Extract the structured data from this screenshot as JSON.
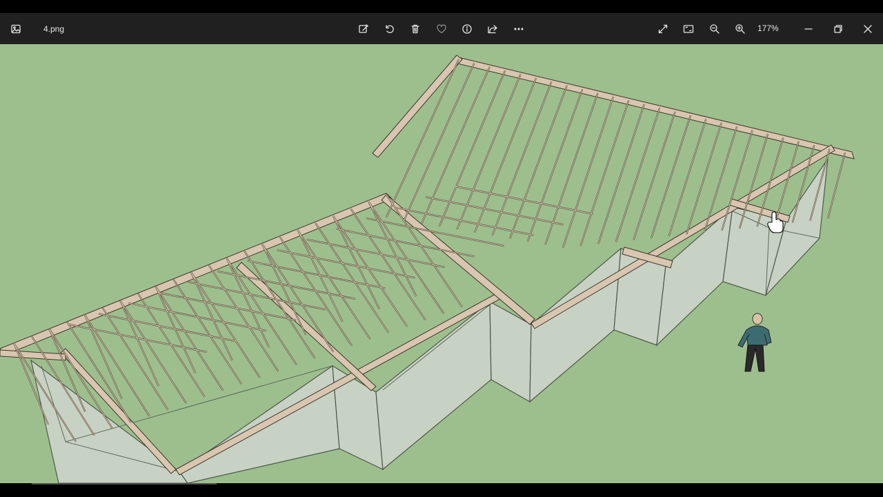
{
  "titlebar": {
    "filename": "4.png",
    "zoom_level": "177%"
  },
  "icons": {
    "app": "photo-app-icon",
    "edit": "edit-image-icon",
    "rotate": "rotate-icon",
    "delete": "trash-icon",
    "favorite": "heart-icon",
    "info": "info-icon",
    "share": "share-icon",
    "more": "more-ellipsis-icon",
    "fullscreen": "fullscreen-icon",
    "fit": "fit-to-window-icon",
    "zoom_out": "zoom-out-icon",
    "zoom_in": "zoom-in-icon",
    "minimize": "minimize-icon",
    "restore": "restore-icon",
    "close": "close-icon"
  },
  "colors": {
    "titlebar_bg": "#202020",
    "canvas_bg": "#9dbf8e",
    "wall": "#c9d3c4",
    "timber": "#d9c6b0"
  }
}
